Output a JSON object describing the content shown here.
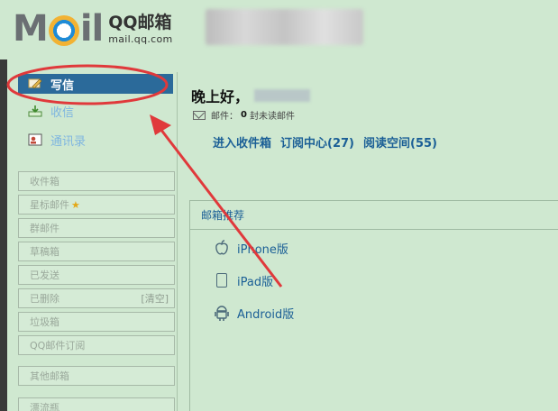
{
  "header": {
    "logo_text_m": "M",
    "logo_text_il": "il",
    "logo_cn": "QQ邮箱",
    "logo_url": "mail.qq.com"
  },
  "sidebar": {
    "actions": [
      {
        "label": "写信",
        "icon": "pencil-icon"
      },
      {
        "label": "收信",
        "icon": "inbox-download-icon"
      },
      {
        "label": "通讯录",
        "icon": "contact-card-icon"
      }
    ],
    "folders": [
      {
        "label": "收件箱"
      },
      {
        "label": "星标邮件",
        "icon": "star-icon"
      },
      {
        "label": "群邮件"
      },
      {
        "label": "草稿箱"
      },
      {
        "label": "已发送"
      },
      {
        "label": "已删除",
        "extra": "[清空]"
      },
      {
        "label": "垃圾箱"
      },
      {
        "label": "QQ邮件订阅"
      },
      {
        "label": "其他邮箱"
      },
      {
        "label": "漂流瓶"
      }
    ]
  },
  "main": {
    "greeting": "晚上好，",
    "mail_label": "邮件：",
    "mail_count": "0",
    "mail_suffix": "封未读邮件",
    "links": [
      "进入收件箱",
      "订阅中心(27)",
      "阅读空间(55)"
    ]
  },
  "recommend": {
    "title": "邮箱推荐",
    "items": [
      {
        "label": "iPhone版",
        "icon": "apple-icon"
      },
      {
        "label": "iPad版",
        "icon": "ipad-icon"
      },
      {
        "label": "Android版",
        "icon": "android-icon"
      }
    ]
  },
  "colors": {
    "background": "#cfe8d0",
    "active_bg": "#2b6a9a",
    "link": "#1b5f96",
    "annotation": "#e0393b"
  }
}
